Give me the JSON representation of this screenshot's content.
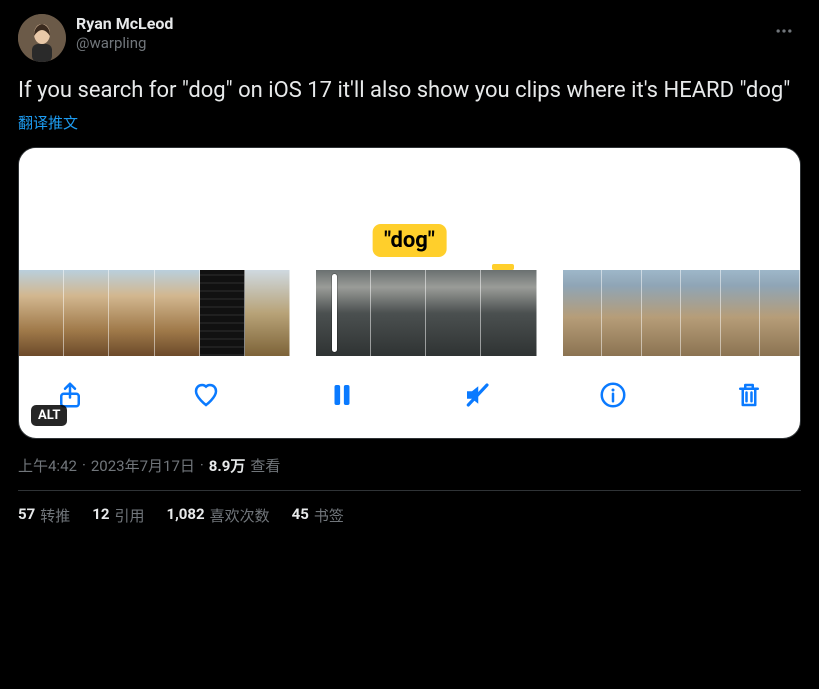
{
  "author": {
    "display_name": "Ryan McLeod",
    "handle": "@warpling"
  },
  "tweet_text": "If you search for \"dog\" on iOS 17 it'll also show you clips where it's HEARD \"dog\"",
  "translate_label": "翻译推文",
  "media": {
    "dog_label": "\"dog\"",
    "alt_badge": "ALT"
  },
  "meta": {
    "time": "上午4:42",
    "date": "2023年7月17日",
    "views_count": "8.9万",
    "views_label": "查看",
    "separator": "·"
  },
  "stats": {
    "retweets": {
      "count": "57",
      "label": "转推"
    },
    "quotes": {
      "count": "12",
      "label": "引用"
    },
    "likes": {
      "count": "1,082",
      "label": "喜欢次数"
    },
    "bookmarks": {
      "count": "45",
      "label": "书签"
    }
  }
}
